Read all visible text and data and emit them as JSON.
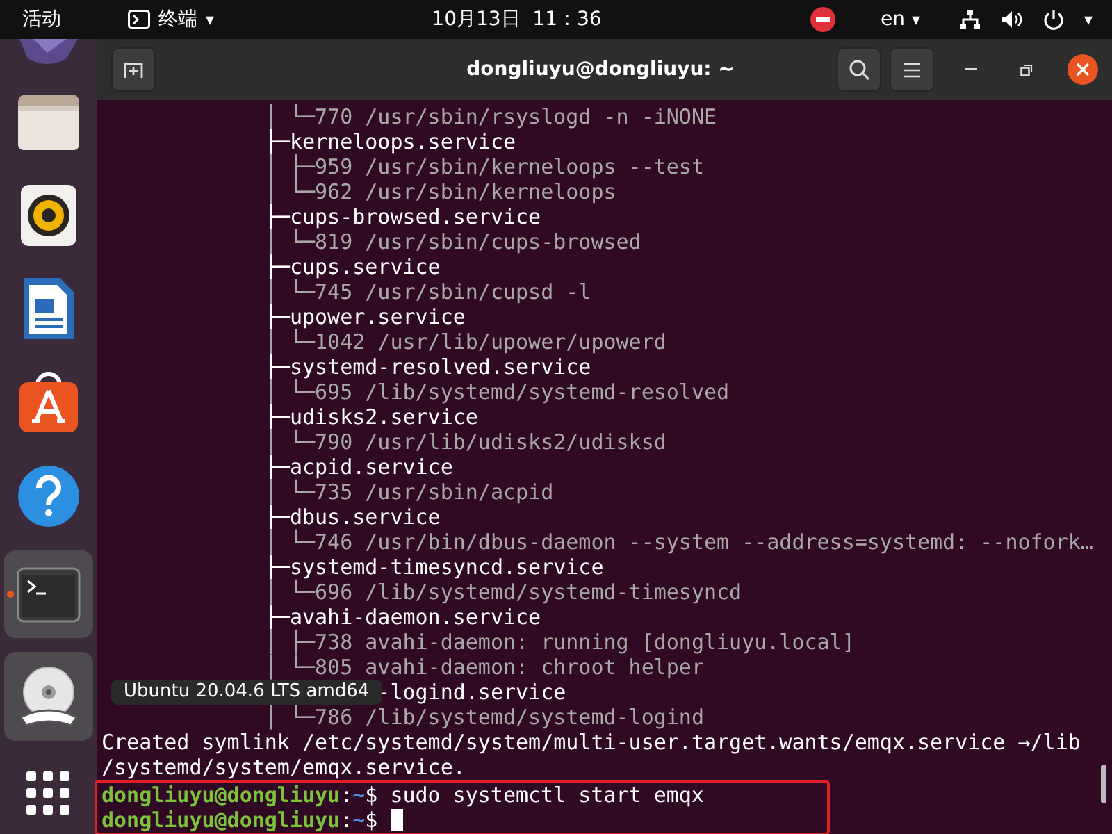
{
  "topbar": {
    "activities": "活动",
    "app_menu": "终端",
    "app_caret": "▾",
    "clock": "10月13日  11：36",
    "language": "en",
    "language_caret": "▾",
    "system_caret": "▾"
  },
  "dock": {
    "items": [
      {
        "kind": "partial",
        "running": false,
        "highlighted": false
      },
      {
        "kind": "files",
        "running": false,
        "highlighted": false
      },
      {
        "kind": "speaker",
        "running": false,
        "highlighted": false
      },
      {
        "kind": "document",
        "running": false,
        "highlighted": false
      },
      {
        "kind": "store",
        "running": false,
        "highlighted": false
      },
      {
        "kind": "help",
        "running": false,
        "highlighted": false
      },
      {
        "kind": "terminal",
        "running": true,
        "highlighted": true
      },
      {
        "kind": "disc",
        "running": false,
        "highlighted": true
      },
      {
        "kind": "grid",
        "running": false,
        "highlighted": false
      }
    ],
    "tooltip": "Ubuntu 20.04.6 LTS amd64"
  },
  "window": {
    "title": "dongliuyu@dongliuyu: ~"
  },
  "terminal": {
    "lines": [
      {
        "kind": "process",
        "text": "             │ └─770 /usr/sbin/rsyslogd -n -iNONE"
      },
      {
        "kind": "unit",
        "text": "             ├─kerneloops.service"
      },
      {
        "kind": "process",
        "text": "             │ ├─959 /usr/sbin/kerneloops --test"
      },
      {
        "kind": "process",
        "text": "             │ └─962 /usr/sbin/kerneloops"
      },
      {
        "kind": "unit",
        "text": "             ├─cups-browsed.service"
      },
      {
        "kind": "process",
        "text": "             │ └─819 /usr/sbin/cups-browsed"
      },
      {
        "kind": "unit",
        "text": "             ├─cups.service"
      },
      {
        "kind": "process",
        "text": "             │ └─745 /usr/sbin/cupsd -l"
      },
      {
        "kind": "unit",
        "text": "             ├─upower.service"
      },
      {
        "kind": "process",
        "text": "             │ └─1042 /usr/lib/upower/upowerd"
      },
      {
        "kind": "unit",
        "text": "             ├─systemd-resolved.service"
      },
      {
        "kind": "process",
        "text": "             │ └─695 /lib/systemd/systemd-resolved"
      },
      {
        "kind": "unit",
        "text": "             ├─udisks2.service"
      },
      {
        "kind": "process",
        "text": "             │ └─790 /usr/lib/udisks2/udisksd"
      },
      {
        "kind": "unit",
        "text": "             ├─acpid.service"
      },
      {
        "kind": "process",
        "text": "             │ └─735 /usr/sbin/acpid"
      },
      {
        "kind": "unit",
        "text": "             ├─dbus.service"
      },
      {
        "kind": "process",
        "text": "             │ └─746 /usr/bin/dbus-daemon --system --address=systemd: --nofork…"
      },
      {
        "kind": "unit",
        "text": "             ├─systemd-timesyncd.service"
      },
      {
        "kind": "process",
        "text": "             │ └─696 /lib/systemd/systemd-timesyncd"
      },
      {
        "kind": "unit",
        "text": "             ├─avahi-daemon.service"
      },
      {
        "kind": "process",
        "text": "             │ ├─738 avahi-daemon: running [dongliuyu.local]"
      },
      {
        "kind": "process",
        "text": "             │ └─805 avahi-daemon: chroot helper"
      },
      {
        "kind": "unit_tail",
        "text": "-logind.service"
      },
      {
        "kind": "process",
        "text": "             │ └─786 /lib/systemd/systemd-logind"
      },
      {
        "kind": "output",
        "text": "Created symlink /etc/systemd/system/multi-user.target.wants/emqx.service →/lib"
      },
      {
        "kind": "output",
        "text": "/systemd/system/emqx.service."
      }
    ],
    "prompts": [
      {
        "user_host": "dongliuyu@dongliuyu",
        "separator": ":",
        "path": "~",
        "symbol": "$",
        "command": "sudo systemctl start emqx",
        "cursor": false
      },
      {
        "user_host": "dongliuyu@dongliuyu",
        "separator": ":",
        "path": "~",
        "symbol": "$",
        "cursor": true
      }
    ]
  }
}
